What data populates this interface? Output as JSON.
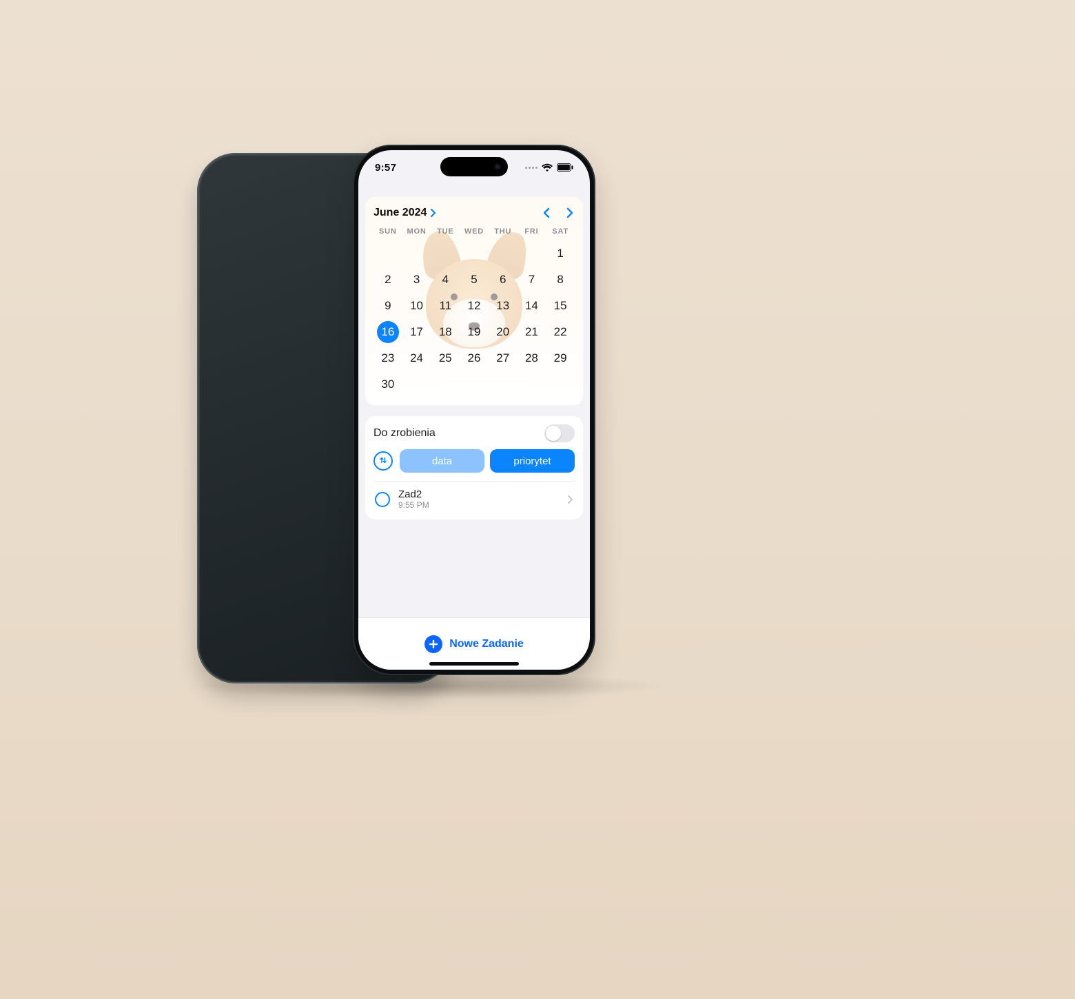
{
  "status": {
    "time": "9:57"
  },
  "calendar": {
    "month_label": "June 2024",
    "dow": [
      "SUN",
      "MON",
      "TUE",
      "WED",
      "THU",
      "FRI",
      "SAT"
    ],
    "first_weekday_index": 6,
    "days_in_month": 30,
    "selected_day": 16
  },
  "tasks": {
    "section_title": "Do zrobienia",
    "seg_a_label": "data",
    "seg_b_label": "priorytet",
    "items": [
      {
        "title": "Zad2",
        "time": "9:55 PM"
      }
    ]
  },
  "bottom": {
    "add_label": "Nowe Zadanie"
  },
  "colors": {
    "accent": "#0a84ff",
    "accent_light": "#8cc3ff",
    "link": "#0a66ff"
  }
}
